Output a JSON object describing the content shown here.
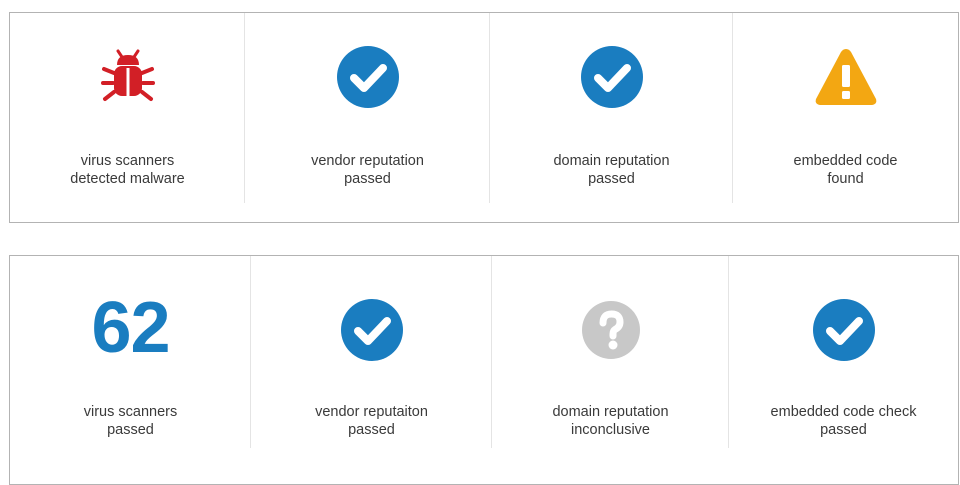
{
  "colors": {
    "malware_red": "#d21f26",
    "check_blue": "#1a7dc0",
    "warning_amber": "#f3a712",
    "unknown_gray": "#c8c8c8",
    "number_blue": "#1a7dc0"
  },
  "top_panel": {
    "cells": [
      {
        "icon": "bug-icon",
        "label_line1": "virus scanners",
        "label_line2": "detected malware"
      },
      {
        "icon": "check-circle-icon",
        "label_line1": "vendor reputation",
        "label_line2": "passed"
      },
      {
        "icon": "check-circle-icon",
        "label_line1": "domain reputation",
        "label_line2": "passed"
      },
      {
        "icon": "warning-triangle-icon",
        "label_line1": "embedded code",
        "label_line2": "found"
      }
    ]
  },
  "bottom_panel": {
    "cells": [
      {
        "value": "62",
        "label_line1": "virus scanners",
        "label_line2": "passed"
      },
      {
        "icon": "check-circle-icon",
        "label_line1": "vendor reputaiton",
        "label_line2": "passed"
      },
      {
        "icon": "question-circle-icon",
        "label_line1": "domain reputation",
        "label_line2": "inconclusive"
      },
      {
        "icon": "check-circle-icon",
        "label_line1": "embedded code check",
        "label_line2": "passed"
      }
    ]
  }
}
